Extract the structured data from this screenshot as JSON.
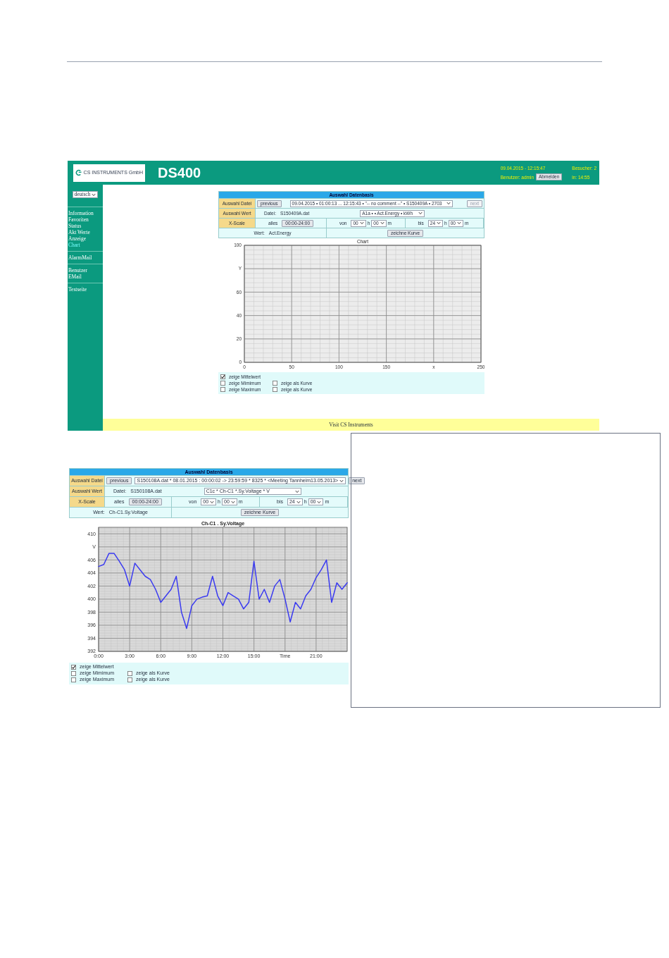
{
  "screenshot": {
    "header": {
      "logo_text": "CS INSTRUMENTS GmbH",
      "title": "DS400",
      "datetime": "09.04.2015 - 12:15:47",
      "visitors": "Besucher: 2",
      "user": "Benutzer: admin",
      "logout_button": "Abmelden",
      "session": "in: 14:55"
    },
    "sidebar": {
      "language": "deutsch",
      "groups": [
        [
          {
            "label": "Information",
            "selected": false
          },
          {
            "label": "Favoriten",
            "selected": false
          },
          {
            "label": "Status",
            "selected": false
          },
          {
            "label": "Akt Werte",
            "selected": false
          },
          {
            "label": "Anzeige",
            "selected": false
          },
          {
            "label": "Chart",
            "selected": true
          }
        ],
        [
          {
            "label": "AlarmMail",
            "selected": false
          }
        ],
        [
          {
            "label": "Benutzer",
            "selected": false
          },
          {
            "label": "EMail",
            "selected": false
          }
        ],
        [
          {
            "label": "Testseite",
            "selected": false
          }
        ]
      ]
    },
    "panel": {
      "title": "Auswahl Datenbasis",
      "file_label": "Auswahl Datei",
      "previous_button": "previous",
      "file_select": "09.04.2015 • 01:00:13 ... 12:15:43 • \"-- no comment --\" • S150409A • 2703",
      "next_button": {
        "label": "next",
        "disabled": true
      },
      "value_label": "Auswahl Wert",
      "datei_label": "Datei:",
      "datei": "S150409A.dat",
      "value_select": "A1a • • Act.Energy • kWh",
      "xscale_label": "X-Scale",
      "alles": "alles",
      "range_button": "00:00-24:00",
      "von": "von",
      "von_h": "00",
      "h1": "h",
      "von_m": "00",
      "m1": "m",
      "bis": "bis",
      "bis_h": "24",
      "h2": "h",
      "bis_m": "00",
      "m2": "m",
      "wert_label": "Wert:",
      "wert": "Act.Energy",
      "draw_button": "zeichne Kurve"
    },
    "chart": {
      "chart_data": {
        "type": "line",
        "grid": true,
        "title": "Chart",
        "xlim": [
          0,
          250
        ],
        "ylim": [
          0,
          100
        ],
        "xticks": [
          0,
          50,
          100,
          150,
          {
            "value": 200,
            "label": "x"
          },
          250
        ],
        "yticks": [
          0,
          20,
          40,
          {
            "value": 60,
            "label": "60"
          },
          {
            "value": 80,
            "label": "Y"
          },
          100
        ]
      }
    },
    "options": [
      {
        "label": "zeige Mittelwert",
        "checked": true
      },
      {
        "label": "zeige Mimimum",
        "checked": false,
        "curve": {
          "label": "zeige als Kurve",
          "checked": false
        }
      },
      {
        "label": "zeige Maximum",
        "checked": false,
        "curve": {
          "label": "zeige als Kurve",
          "checked": false
        }
      }
    ],
    "footer": "Visit CS Instruments"
  },
  "example": {
    "panel": {
      "title": "Auswahl Datenbasis",
      "file_label": "Auswahl Datei",
      "previous_button": "previous",
      "file_select": "S150108A.dat * 08.01.2015 : 00:00:02 -> 23:59:59 * 8325 * <Meeting Tannheim13.05.2013>",
      "next_button": {
        "label": "next",
        "disabled": false
      },
      "value_label": "Auswahl Wert",
      "datei_label": "Datei:",
      "datei": "S150108A.dat",
      "value_select": "C1c * Ch-C1 *.Sy.Voltage * V",
      "xscale_label": "X-Scale",
      "alles": "alles",
      "range_button": "00:00-24:00",
      "von": "von",
      "von_h": "00",
      "h1": "h",
      "von_m": "00",
      "m1": "m",
      "bis": "bis",
      "bis_h": "24",
      "h2": "h",
      "bis_m": "00",
      "m2": "m",
      "wert_label": "Wert:",
      "wert": "Ch-C1.Sy.Voltage",
      "draw_button": "zeichne Kurve"
    },
    "chart": {
      "chart_data": {
        "type": "line",
        "grid": true,
        "title": "Ch-C1 . Sy.Voltage",
        "xlim": [
          0,
          24
        ],
        "ylim": [
          392,
          411
        ],
        "xticks": [
          {
            "value": 0,
            "label": "0:00"
          },
          {
            "value": 3,
            "label": "3:00"
          },
          {
            "value": 6,
            "label": "6:00"
          },
          {
            "value": 9,
            "label": "9:00"
          },
          {
            "value": 12,
            "label": "12:00"
          },
          {
            "value": 15,
            "label": "15:00"
          },
          {
            "value": 18,
            "label": "Time"
          },
          {
            "value": 21,
            "label": "21:00"
          }
        ],
        "yticks": [
          392,
          394,
          396,
          398,
          400,
          402,
          404,
          {
            "value": 406,
            "label": "406"
          },
          {
            "value": 408,
            "label": "V"
          },
          410
        ],
        "x": [
          0,
          0.5,
          1,
          1.5,
          2,
          2.5,
          3,
          3.5,
          4,
          4.5,
          5,
          5.5,
          6,
          6.5,
          7,
          7.5,
          8,
          8.5,
          9,
          9.5,
          10,
          10.5,
          11,
          11.5,
          12,
          12.5,
          13,
          13.5,
          14,
          14.5,
          15,
          15.5,
          16,
          16.5,
          17,
          17.5,
          18,
          18.5,
          19,
          19.5,
          20,
          20.5,
          21,
          21.5,
          22,
          22.5,
          23,
          23.5,
          24
        ],
        "series": [
          {
            "color": "#3b3bf0",
            "values": [
              405,
              405.3,
              407,
              407,
              405.8,
              404.5,
              402,
              405.5,
              404.5,
              403.5,
              403,
              401.5,
              399.5,
              400.5,
              401.5,
              403.5,
              398,
              395.5,
              399,
              400,
              400.3,
              400.5,
              403.5,
              400.5,
              399,
              401,
              400.5,
              400,
              398.5,
              399.5,
              405.8,
              400,
              401.5,
              399.5,
              402,
              403,
              400,
              396.5,
              399.5,
              398.5,
              400.5,
              401.5,
              403.3,
              404.5,
              406,
              399.5,
              402.5,
              401.5,
              402.5
            ]
          }
        ]
      }
    },
    "options": [
      {
        "label": "zeige Mittelwert",
        "checked": true
      },
      {
        "label": "zeige Mimimum",
        "checked": false,
        "curve": {
          "label": "zeige als Kurve",
          "checked": false
        }
      },
      {
        "label": "zeige Maximum",
        "checked": false,
        "curve": {
          "label": "zeige als Kurve",
          "checked": false
        }
      }
    ]
  }
}
